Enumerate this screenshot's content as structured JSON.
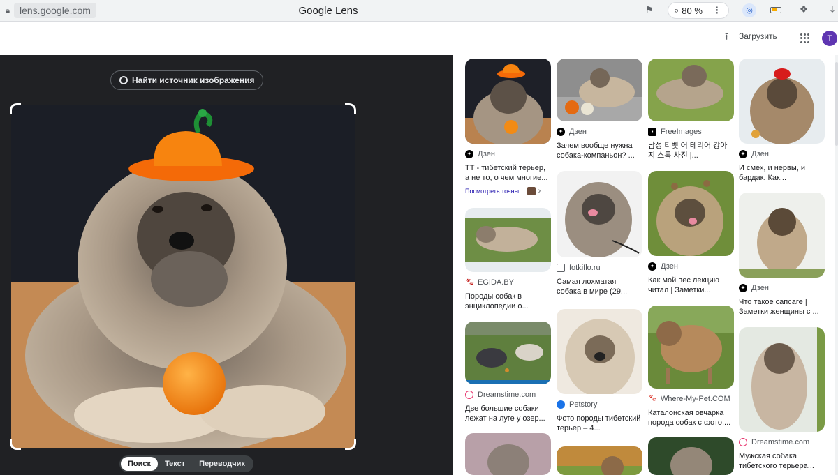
{
  "browser": {
    "url": "lens.google.com",
    "title": "Google Lens",
    "zoom": "80 %"
  },
  "header": {
    "upload_label": "Загрузить",
    "avatar_letter": "T"
  },
  "left": {
    "find_source_label": "Найти источник изображения",
    "modes": [
      "Поиск",
      "Текст",
      "Переводчик"
    ],
    "active_mode": "Поиск"
  },
  "results": [
    {
      "source": "Дзен",
      "title": "ТТ - тибетский терьер, а не то, о чем многие...",
      "exact_link": "Посмотреть точны..."
    },
    {
      "source": "EGIDA.BY",
      "title": "Породы собак в энциклопедии о..."
    },
    {
      "source": "Dreamstime.com",
      "title": "Две большие собаки лежат на луге у озер..."
    },
    {
      "source": "Дзен",
      "title": "Зачем вообще нужна собака-компаньон? ..."
    },
    {
      "source": "fotkiflo.ru",
      "title": "Самая лохматая собака в мире (29..."
    },
    {
      "source": "Petstory",
      "title": "Фото породы тибетский терьер – 4..."
    },
    {
      "source": "FreeImages",
      "title": "남성 티벳 어 테리어 강아지 스톡 사진 |..."
    },
    {
      "source": "Дзен",
      "title": "Как мой пес лекцию читал | Заметки..."
    },
    {
      "source": "Where-My-Pet.COM",
      "title": "Каталонская овчарка порода собак с фото,..."
    },
    {
      "source": "Дзен",
      "title": "И смех, и нервы, и бардак. Как..."
    },
    {
      "source": "Дзен",
      "title": "Что такое сапсаге | Заметки женщины с ..."
    },
    {
      "source": "Dreamstime.com",
      "title": "Мужская собака тибетского терьера..."
    }
  ],
  "colors": {
    "left_panel_bg": "#202124",
    "accent_link": "#1a0dab",
    "avatar_bg": "#5e35b1"
  }
}
